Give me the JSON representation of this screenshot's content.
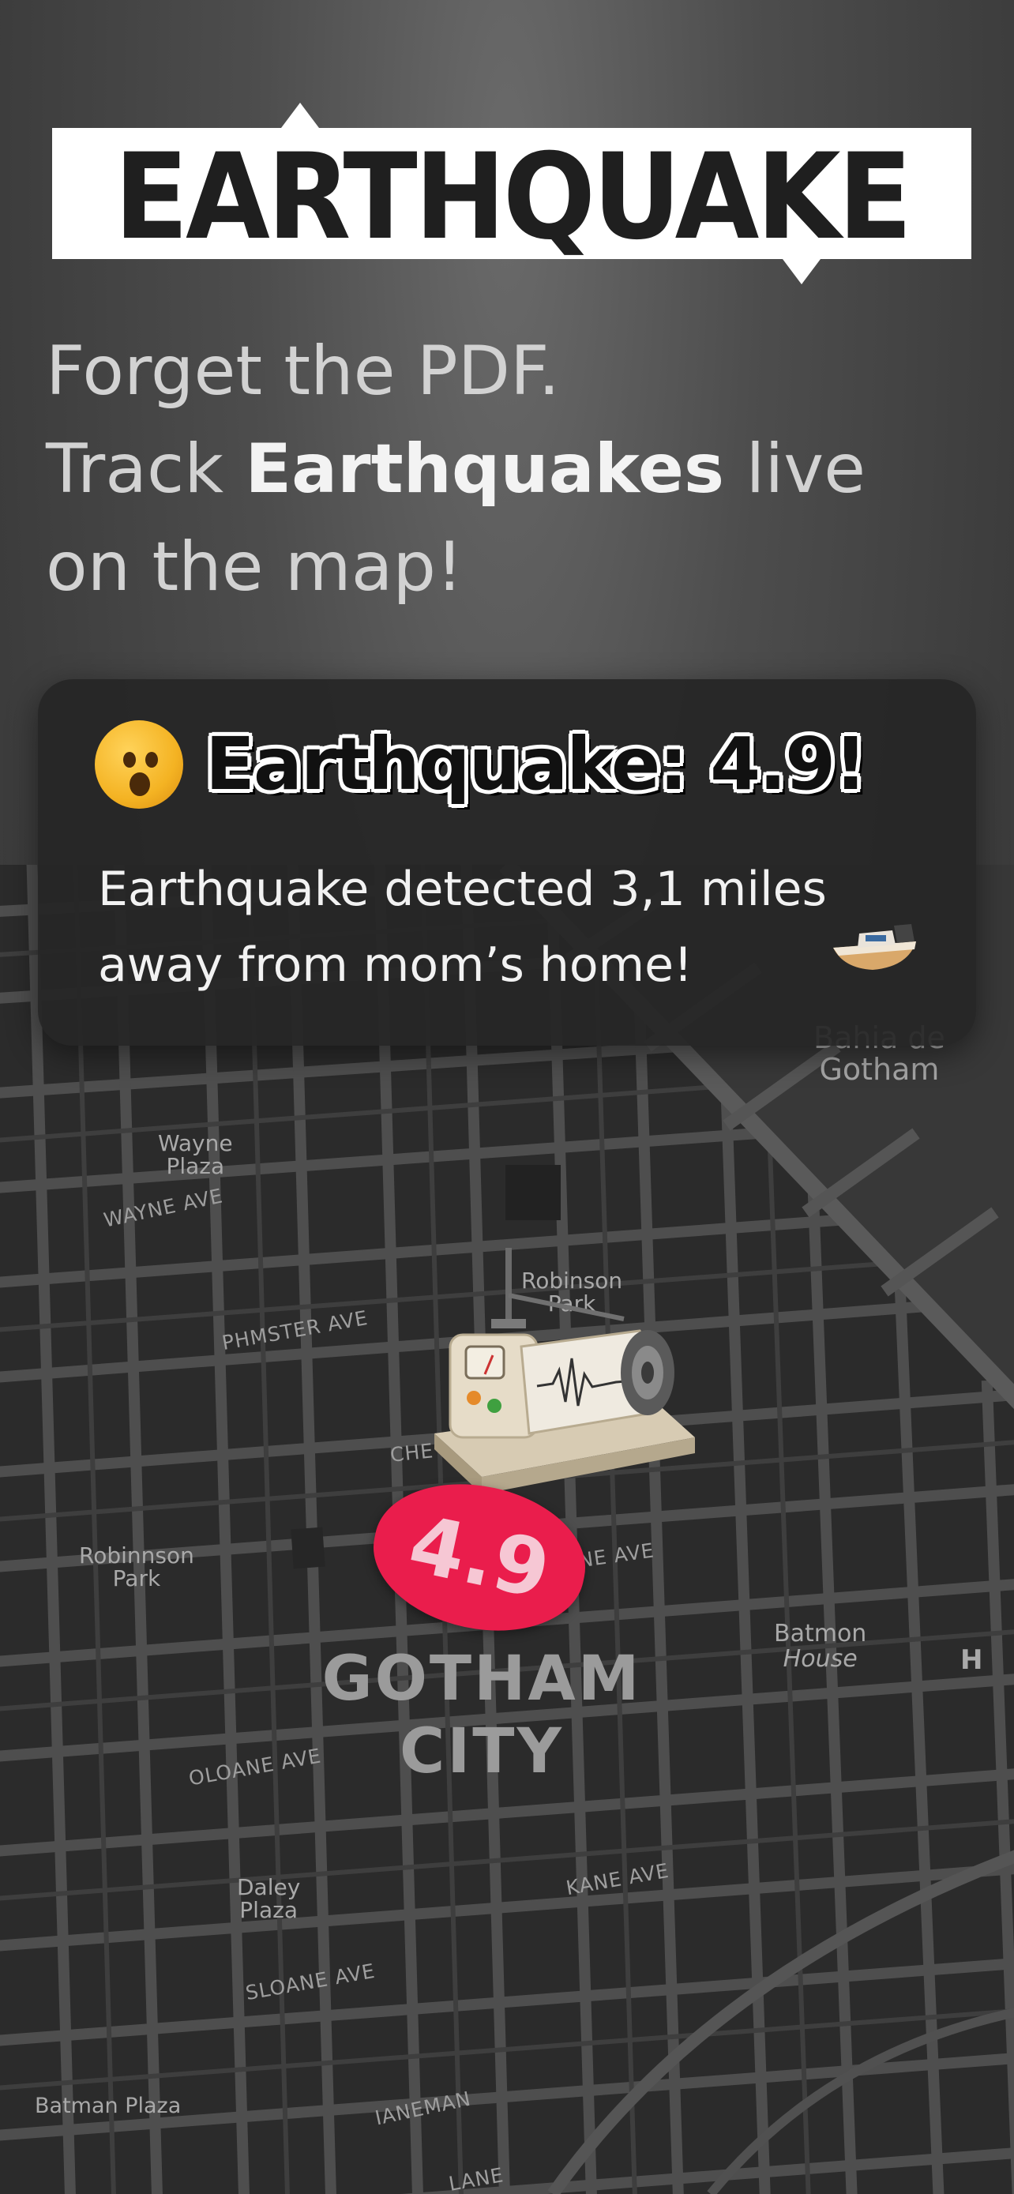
{
  "logo": {
    "text": "EARTHQUAKE"
  },
  "headline": {
    "line1": "Forget the PDF.",
    "line2_prefix": "Track ",
    "line2_bold": "Earthquakes",
    "line2_suffix": " live",
    "line3": "on the map!"
  },
  "notification": {
    "emoji_icon": "astonished-face-emoji",
    "title": "Earthquake: 4.9!",
    "body_line1": "Earthquake detected 3,1 miles",
    "body_line2": "away from mom’s home!"
  },
  "map": {
    "city_line1": "GOTHAM",
    "city_line2": "CITY",
    "marker": {
      "magnitude": "4.9",
      "icon": "seismograph-icon",
      "color": "#ea1d4c"
    },
    "places": {
      "wayne_plaza_1": "Wayne",
      "wayne_plaza_2": "Plaza",
      "robinson_park_1": "Robinson",
      "robinson_park_2": "Park",
      "robinnson_park_1": "Robinnson",
      "robinnson_park_2": "Park",
      "bahia_1": "Bahia de",
      "bahia_2": "Gotham",
      "batmon_1": "Batmon",
      "batmon_2": "House",
      "daley_1": "Daley",
      "daley_2": "Plaza",
      "batman_plaza": "Batman Plaza",
      "h_marker": "H"
    },
    "streets": {
      "wayne_ave": "WAYNE AVE",
      "phmster_ave": "PHMSTER AVE",
      "che": "CHE",
      "ne_ave": "NE AVE",
      "oloane_ave": "OLOANE AVE",
      "kane_ave": "KANE AVE",
      "sloane_ave": "SLOANE AVE",
      "ianeman": "IANEMAN",
      "lane": "LANE"
    }
  }
}
